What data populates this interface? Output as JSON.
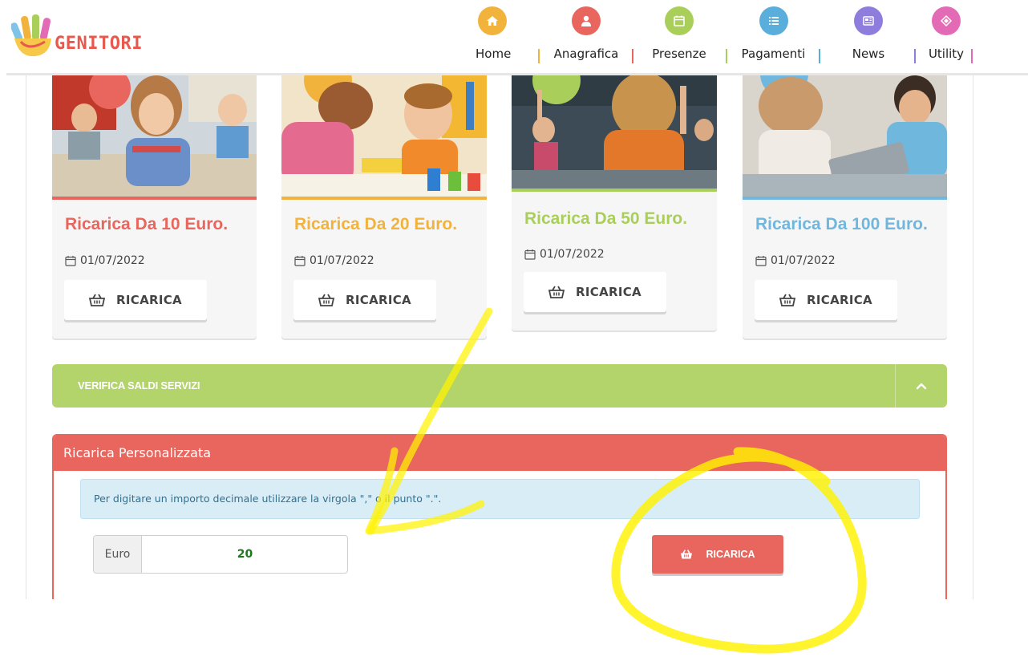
{
  "app": {
    "logo_text": "GENITORI"
  },
  "nav": {
    "items": [
      {
        "label": "Home",
        "icon": "home-icon",
        "color": "#f2b33d"
      },
      {
        "label": "Anagrafica",
        "icon": "user-icon",
        "color": "#e8665d"
      },
      {
        "label": "Presenze",
        "icon": "calendar-icon",
        "color": "#a9cf5a"
      },
      {
        "label": "Pagamenti",
        "icon": "list-icon",
        "color": "#5aaedc"
      },
      {
        "label": "News",
        "icon": "newspaper-icon",
        "color": "#8e7ddc"
      },
      {
        "label": "Utility",
        "icon": "share-icon",
        "color": "#e36ab5"
      }
    ]
  },
  "cards": [
    {
      "title": "Ricarica Da 10 Euro.",
      "date": "01/07/2022",
      "button_label": "RICARICA",
      "color": "#e8665d"
    },
    {
      "title": "Ricarica Da 20 Euro.",
      "date": "01/07/2022",
      "button_label": "RICARICA",
      "color": "#f2b33d"
    },
    {
      "title": "Ricarica Da 50 Euro.",
      "date": "01/07/2022",
      "button_label": "RICARICA",
      "color": "#a9cf5a"
    },
    {
      "title": "Ricarica Da 100 Euro.",
      "date": "01/07/2022",
      "button_label": "RICARICA",
      "color": "#6fb7dd"
    }
  ],
  "verifica": {
    "label": "VERIFICA SALDI SERVIZI",
    "color": "#b2d46a"
  },
  "personalizzata": {
    "title": "Ricarica Personalizzata",
    "info_text": "Per digitare un importo decimale utilizzare la virgola \",\" o il punto \".\".",
    "currency_label": "Euro",
    "amount_value": "20",
    "button_label": "RICARICA",
    "color": "#e8665d"
  },
  "annotation": {
    "color": "#fff200"
  }
}
